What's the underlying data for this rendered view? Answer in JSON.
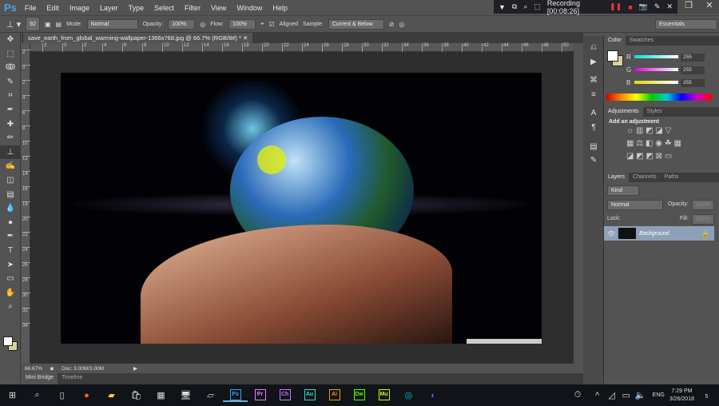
{
  "app": {
    "logo": "Ps",
    "menus": [
      "File",
      "Edit",
      "Image",
      "Layer",
      "Type",
      "Select",
      "Filter",
      "View",
      "Window",
      "Help"
    ]
  },
  "recorder": {
    "status": "Recording [00:08:26]"
  },
  "options": {
    "brush_size": "92",
    "mode_label": "Mode:",
    "mode": "Normal",
    "opacity_label": "Opacity:",
    "opacity": "100%",
    "flow_label": "Flow:",
    "flow": "100%",
    "aligned_label": "Aligned",
    "aligned_checked": true,
    "sample_label": "Sample:",
    "sample": "Current & Below",
    "workspace": "Essentials"
  },
  "document": {
    "tab_title": "save_earth_from_global_warming-wallpaper-1366x768.jpg @ 66.7% (RGB/8#) *",
    "zoom": "66.67%",
    "doc_size": "Doc: 3.00M/3.00M"
  },
  "ruler": {
    "top": [
      "2",
      "0",
      "2",
      "4",
      "6",
      "8",
      "10",
      "12",
      "14",
      "16",
      "18",
      "20",
      "22",
      "24",
      "26",
      "28",
      "30",
      "32",
      "34",
      "36",
      "38",
      "40",
      "42",
      "44",
      "46",
      "48",
      "50"
    ],
    "left": [
      "2",
      "0",
      "2",
      "4",
      "6",
      "8",
      "10",
      "12",
      "14",
      "16",
      "18",
      "20",
      "22",
      "24",
      "26",
      "28",
      "30",
      "32",
      "34"
    ]
  },
  "bottom_tabs": [
    "Mini Bridge",
    "Timeline"
  ],
  "color_panel": {
    "tabs": [
      "Color",
      "Swatches"
    ],
    "r_label": "R",
    "g_label": "G",
    "b_label": "B",
    "r": "255",
    "g": "255",
    "b": "255",
    "foreground": "#ffffff",
    "background": "#d8d29a"
  },
  "adjustments_panel": {
    "tabs": [
      "Adjustments",
      "Styles"
    ],
    "heading": "Add an adjustment"
  },
  "layers_panel": {
    "tabs": [
      "Layers",
      "Channels",
      "Paths"
    ],
    "filter": "Kind",
    "blend": "Normal",
    "opacity_label": "Opacity:",
    "opacity": "100%",
    "lock_label": "Lock:",
    "fill_label": "Fill:",
    "fill": "100%",
    "layers": [
      {
        "name": "Background",
        "visible": true,
        "locked": true
      }
    ]
  },
  "taskbar": {
    "apps": [
      "Ps",
      "Pr",
      "Ch",
      "Au",
      "Ai",
      "Dw",
      "Mu"
    ],
    "lang": "ENG",
    "time": "7:29 PM",
    "date": "3/26/2018",
    "notifications": "5"
  }
}
